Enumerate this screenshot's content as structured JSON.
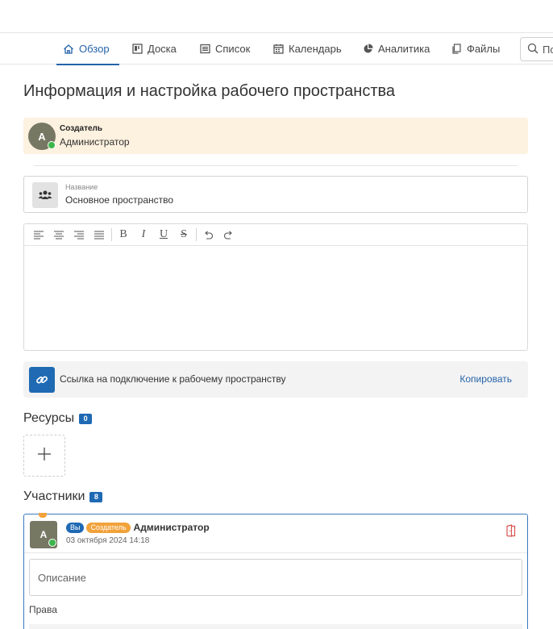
{
  "tabs": [
    {
      "label": "Обзор",
      "icon": "home-icon",
      "active": true
    },
    {
      "label": "Доска",
      "icon": "board-icon",
      "active": false
    },
    {
      "label": "Список",
      "icon": "list-icon",
      "active": false
    },
    {
      "label": "Календарь",
      "icon": "calendar-icon",
      "active": false
    },
    {
      "label": "Аналитика",
      "icon": "pie-chart-icon",
      "active": false
    },
    {
      "label": "Файлы",
      "icon": "files-icon",
      "active": false
    }
  ],
  "search": {
    "visible_text": "По"
  },
  "page": {
    "title": "Информация и настройка рабочего пространства"
  },
  "creator": {
    "label": "Создатель",
    "name": "Администратор",
    "avatar_letter": "A"
  },
  "workspace_name": {
    "label": "Название",
    "value": "Основное пространство"
  },
  "editor": {
    "toolbar": [
      "align-left-icon",
      "align-center-icon",
      "align-right-icon",
      "align-justify-icon",
      "bold-icon",
      "italic-icon",
      "underline-icon",
      "strikethrough-icon",
      "undo-icon",
      "redo-icon"
    ],
    "buttons": {
      "bold": "B",
      "italic": "I",
      "underline": "U",
      "strike": "S"
    }
  },
  "invite_link": {
    "text": "Ссылка на подключение к рабочему пространству",
    "copy_label": "Копировать"
  },
  "resources": {
    "title": "Ресурсы",
    "count": "0"
  },
  "members": {
    "title": "Участники",
    "count": "8",
    "items": [
      {
        "you_badge": "Вы",
        "role_badge": "Создатель",
        "name": "Администратор",
        "date": "03 октября 2024 14:18",
        "avatar_letter": "A",
        "description_placeholder": "Описание",
        "rights_label": "Права"
      }
    ]
  },
  "colors": {
    "accent": "#2563a8",
    "creator_bg": "#fdf1df",
    "badge_orange": "#f2a23a",
    "leave_red": "#d9534f",
    "online": "#3cb54a"
  }
}
